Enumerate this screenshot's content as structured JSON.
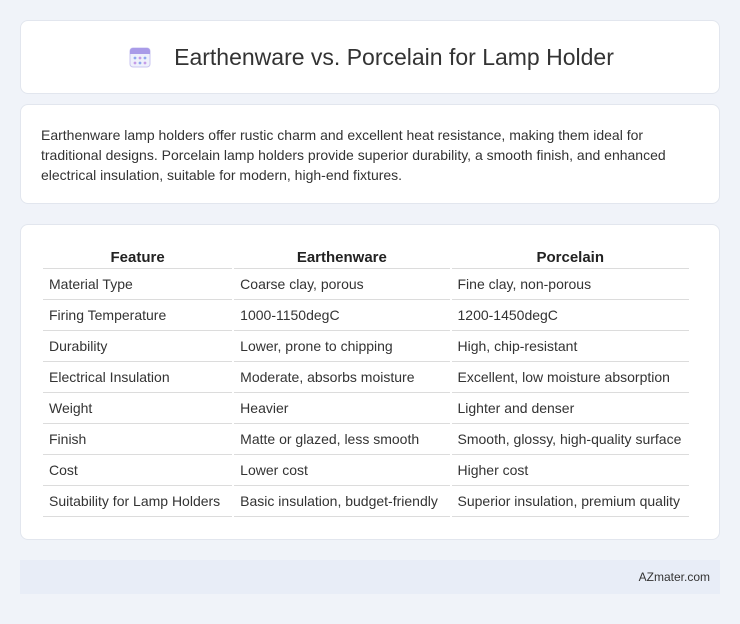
{
  "header": {
    "title": "Earthenware vs. Porcelain for Lamp Holder",
    "icon": "calendar-grid-icon",
    "icon_colors": {
      "top": "#a99be8",
      "body": "#eef0fb",
      "dots": "#8fa8ee"
    }
  },
  "description": "Earthenware lamp holders offer rustic charm and excellent heat resistance, making them ideal for traditional designs. Porcelain lamp holders provide superior durability, a smooth finish, and enhanced electrical insulation, suitable for modern, high-end fixtures.",
  "table": {
    "headers": [
      "Feature",
      "Earthenware",
      "Porcelain"
    ],
    "rows": [
      [
        "Material Type",
        "Coarse clay, porous",
        "Fine clay, non-porous"
      ],
      [
        "Firing Temperature",
        "1000-1150degC",
        "1200-1450degC"
      ],
      [
        "Durability",
        "Lower, prone to chipping",
        "High, chip-resistant"
      ],
      [
        "Electrical Insulation",
        "Moderate, absorbs moisture",
        "Excellent, low moisture absorption"
      ],
      [
        "Weight",
        "Heavier",
        "Lighter and denser"
      ],
      [
        "Finish",
        "Matte or glazed, less smooth",
        "Smooth, glossy, high-quality surface"
      ],
      [
        "Cost",
        "Lower cost",
        "Higher cost"
      ],
      [
        "Suitability for Lamp Holders",
        "Basic insulation, budget-friendly",
        "Superior insulation, premium quality"
      ]
    ]
  },
  "footer": {
    "text": "AZmater.com"
  }
}
